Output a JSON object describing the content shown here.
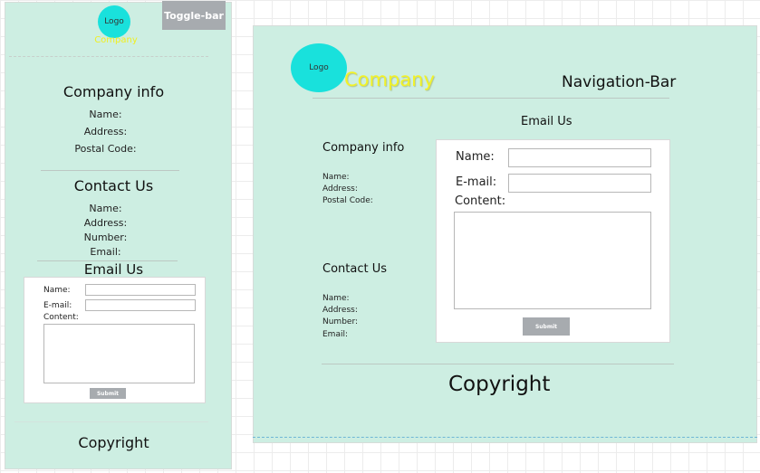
{
  "mobile": {
    "logo_label": "Logo",
    "company_label": "Company",
    "toggle_label": "Toggle-bar",
    "company_info": {
      "title": "Company info",
      "fields": [
        "Name:",
        "Address:",
        "Postal Code:"
      ]
    },
    "contact_us": {
      "title": "Contact Us",
      "fields": [
        "Name:",
        "Address:",
        "Number:",
        "Email:"
      ]
    },
    "email_us": {
      "title": "Email Us",
      "name_label": "Name:",
      "email_label": "E-mail:",
      "content_label": "Content:",
      "submit_label": "Submit"
    },
    "copyright": "Copyright"
  },
  "desktop": {
    "logo_label": "Logo",
    "company_label": "Company",
    "navbar_label": "Navigation-Bar",
    "email_us": {
      "title": "Email Us",
      "name_label": "Name:",
      "email_label": "E-mail:",
      "content_label": "Content:",
      "submit_label": "Submit"
    },
    "company_info": {
      "title": "Company info",
      "fields": [
        "Name:",
        "Address:",
        "Postal Code:"
      ]
    },
    "contact_us": {
      "title": "Contact Us",
      "fields": [
        "Name:",
        "Address:",
        "Number:",
        "Email:"
      ]
    },
    "copyright": "Copyright"
  },
  "colors": {
    "panel_bg": "#cdeee2",
    "logo_circle": "#19e1dc",
    "company_text": "#f2f226",
    "button_gray": "#a7abaf"
  }
}
